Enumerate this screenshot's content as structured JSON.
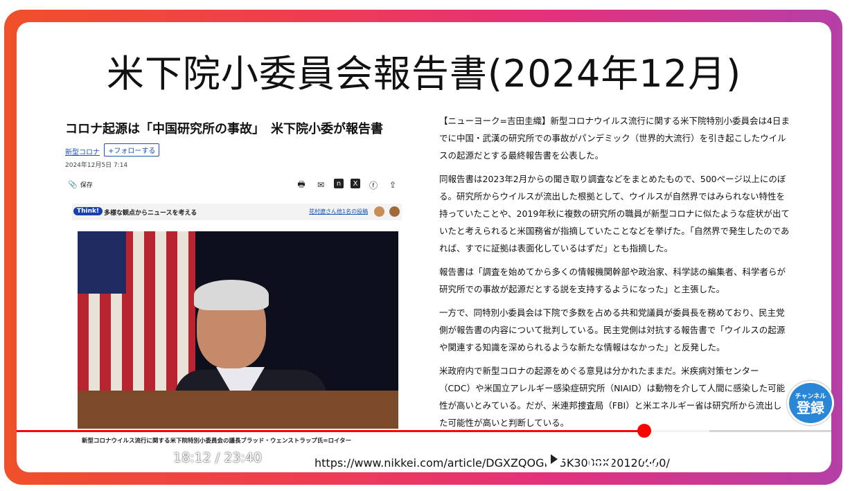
{
  "slide": {
    "title": "米下院小委員会報告書(2024年12月)"
  },
  "article": {
    "headline": "コロナ起源は「中国研究所の事故」　米下院小委が報告書",
    "tag": "新型コロナ",
    "follow_label": "+フォローする",
    "date": "2024年12月5日 7:14",
    "save_label": "保存",
    "think_badge": "Think!",
    "think_text": "多様な観点からニュースを考える",
    "think_link": "花村遼さん他1名の投稿",
    "caption": "新型コロナウイルス流行に関する米下院特別小委員会の議長ブラッド・ウェンストラップ氏=ロイター",
    "paragraphs": [
      "【ニューヨーク=吉田圭織】新型コロナウイルス流行に関する米下院特別小委員会は4日までに中国・武漢の研究所での事故がパンデミック（世界的大流行）を引き起こしたウイルスの起源だとする最終報告書を公表した。",
      "同報告書は2023年2月からの聞き取り調査などをまとめたもので、500ページ以上にのぼる。研究所からウイルスが流出した根拠として、ウイルスが自然界ではみられない特性を持っていたことや、2019年秋に複数の研究所の職員が新型コロナに似たような症状が出ていたと考えられると米国務省が指摘していたことなどを挙げた。「自然界で発生したのであれば、すでに証拠は表面化しているはずだ」とも指摘した。",
      "報告書は「調査を始めてから多くの情報機関幹部や政治家、科学誌の編集者、科学者らが研究所での事故が起源だとする説を支持するようになった」と主張した。",
      "一方で、同特別小委員会は下院で多数を占める共和党議員が委員長を務めており、民主党側が報告書の内容について批判している。民主党側は対抗する報告書で「ウイルスの起源や関連する知識を深められるような新たな情報はなかった」と反発した。",
      "米政府内で新型コロナの起源をめぐる意見は分かれたままだ。米疾病対策センター（CDC）や米国立アレルギー感染症研究所（NIAID）は動物を介して人間に感染した可能性が高いとみている。だが、米連邦捜査局（FBI）と米エネルギー省は研究所から流出した可能性が高いと判断している。"
    ]
  },
  "player": {
    "time": "18:12 / 23:40",
    "progress_fraction": 0.77,
    "url_overlay": "https://www.nikkei.com/article/DGXZQOGN05K3000X20120000/",
    "subscribe_small": "チャンネル",
    "subscribe_big": "登録"
  },
  "colors": {
    "frame_start": "#f0502a",
    "frame_end": "#b43fa6",
    "progress": "#ff0000",
    "subscribe": "#2a86d6"
  }
}
